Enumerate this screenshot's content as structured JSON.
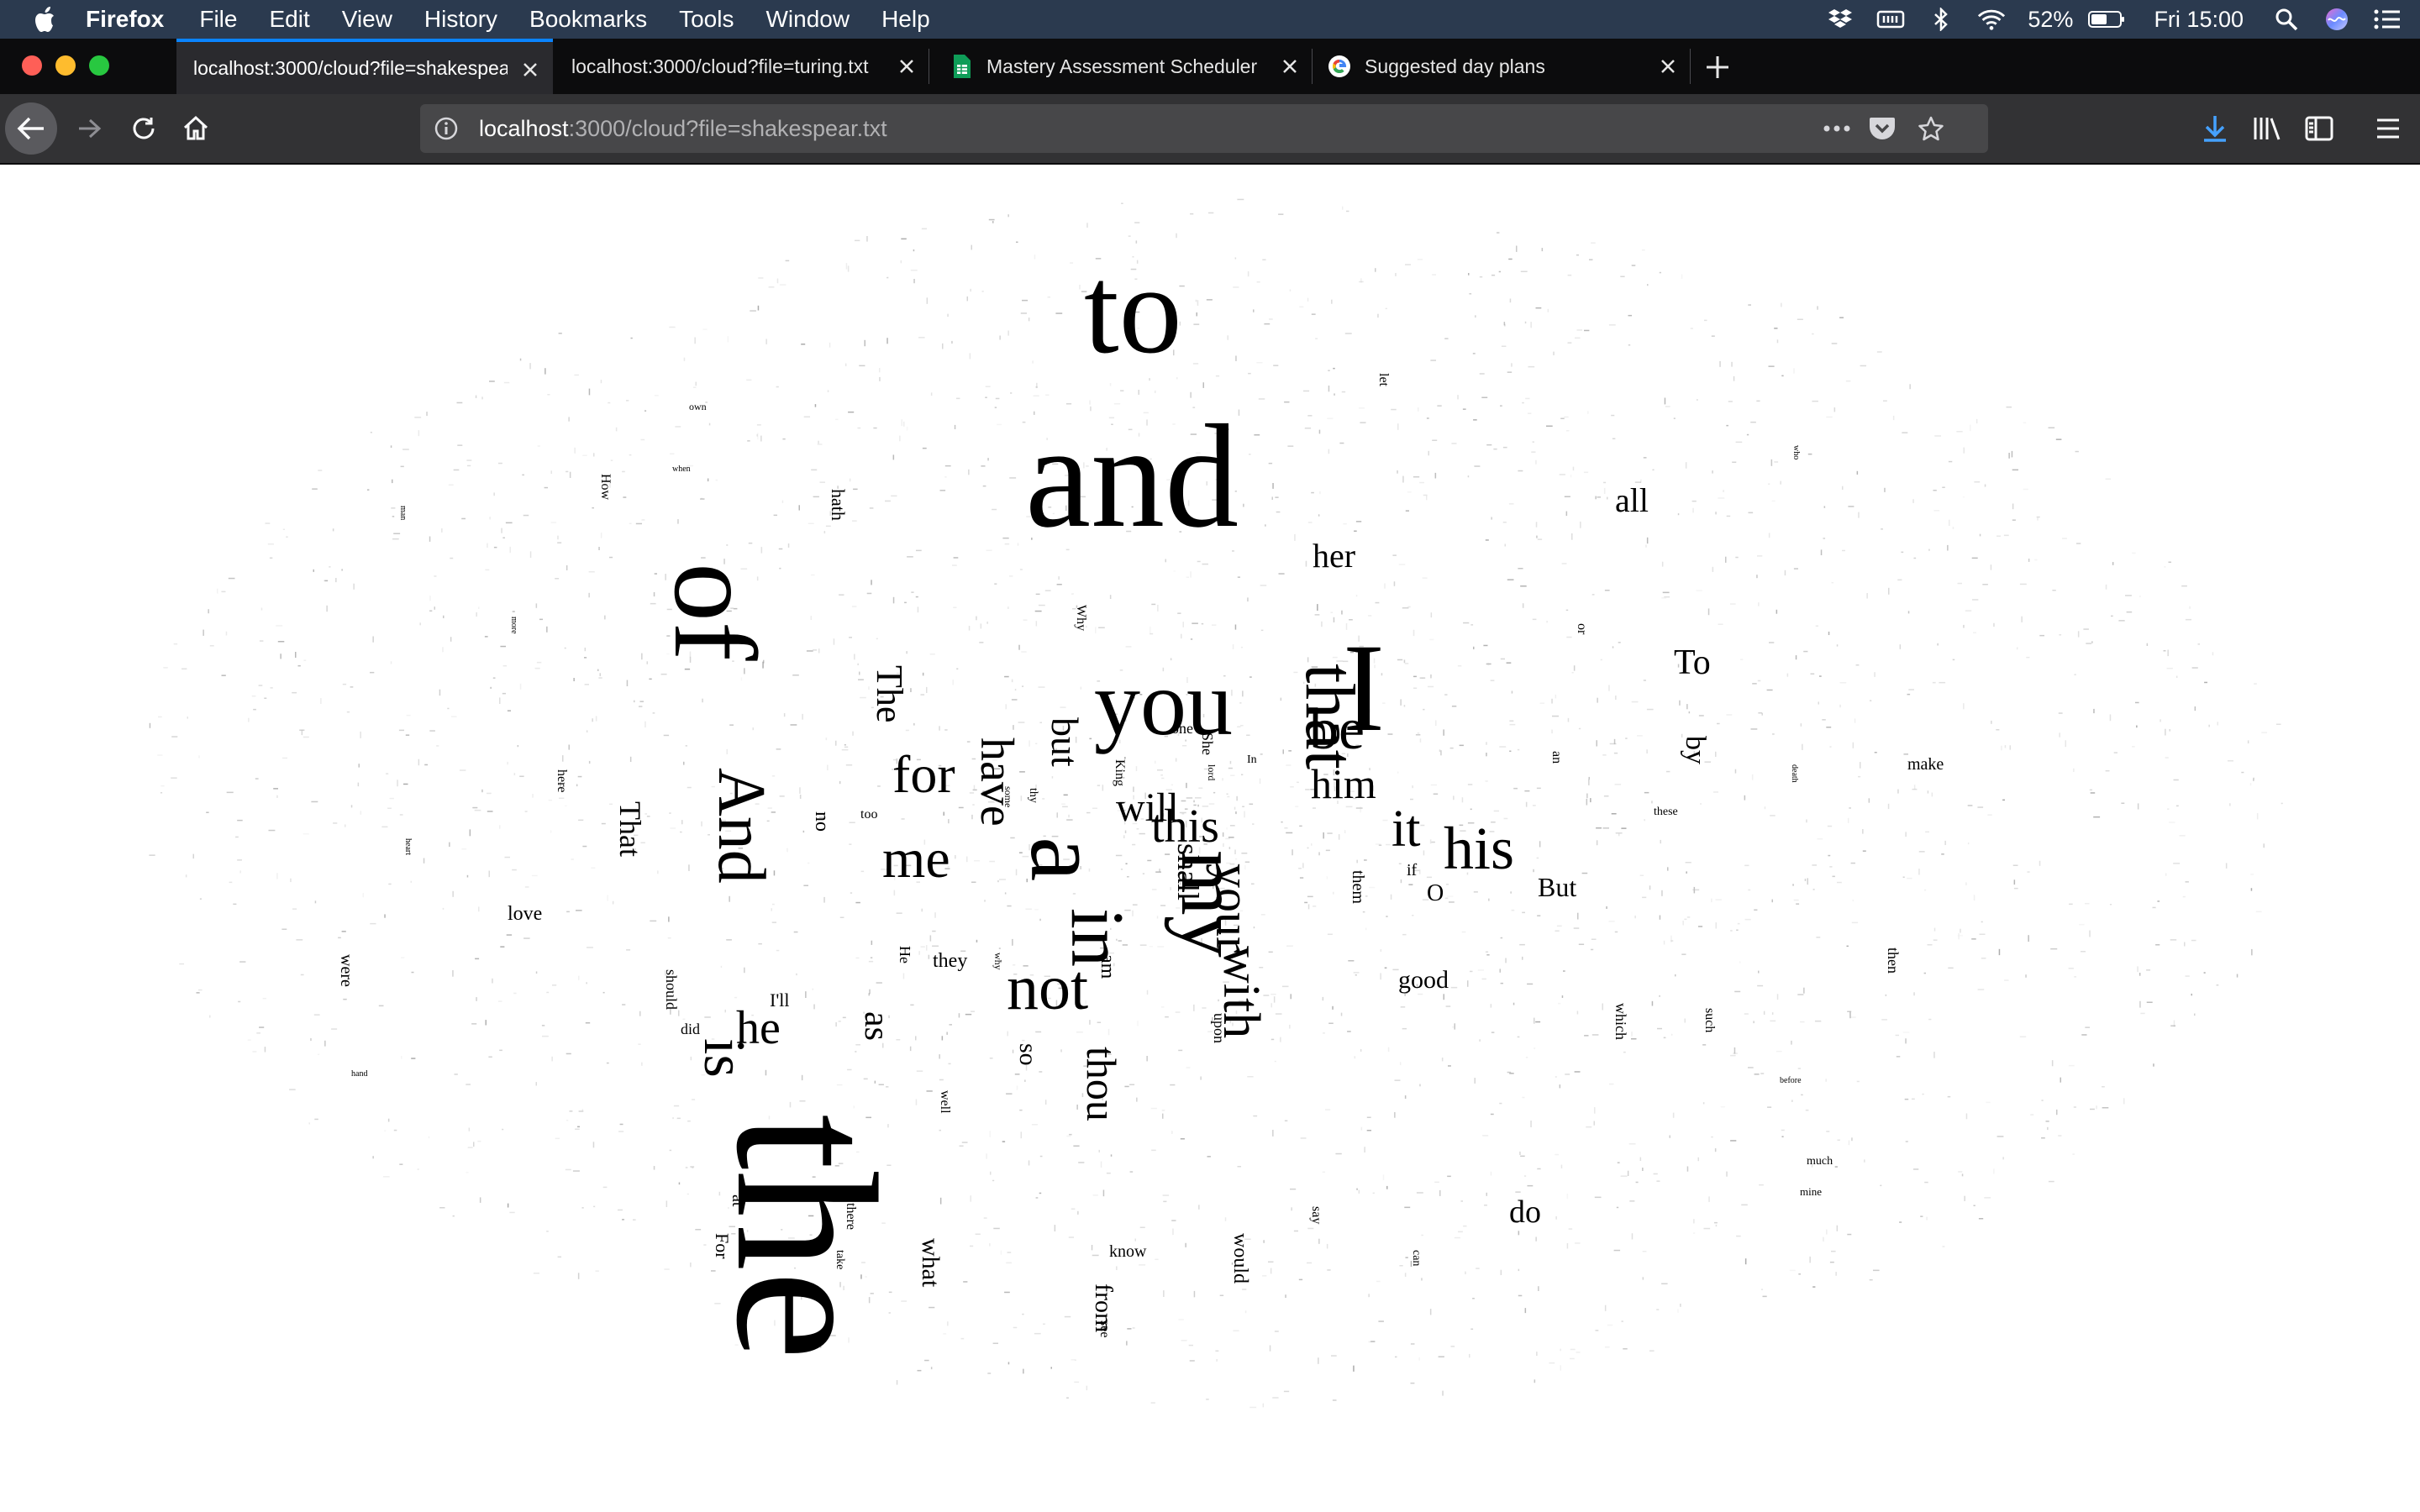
{
  "menubar": {
    "app_name": "Firefox",
    "items": [
      "File",
      "Edit",
      "View",
      "History",
      "Bookmarks",
      "Tools",
      "Window",
      "Help"
    ],
    "battery": "52%",
    "clock": "Fri 15:00",
    "icons": [
      "apple-icon",
      "dropbox-icon",
      "display-icon",
      "bluetooth-icon",
      "wifi-icon",
      "battery-icon",
      "spotlight-search-icon",
      "siri-icon",
      "notification-center-icon"
    ]
  },
  "tabs": [
    {
      "label": "localhost:3000/cloud?file=shakespear.txt",
      "active": true
    },
    {
      "label": "localhost:3000/cloud?file=turing.txt",
      "active": false
    },
    {
      "label": "Mastery Assessment Scheduler",
      "active": false,
      "favicon": "sheets-icon"
    },
    {
      "label": "Suggested day plans",
      "active": false,
      "favicon": "google-icon"
    }
  ],
  "toolbar": {
    "url_host": "localhost",
    "url_rest": ":3000/cloud?file=shakespear.txt"
  },
  "colors": {
    "menubar_bg": "#2b3a4f",
    "tabstrip_bg": "#0c0c0d",
    "active_tab_bg": "#2a2a2e",
    "active_tab_accent": "#0a84ff",
    "toolbar_bg": "#323234",
    "urlbar_bg": "#474749",
    "download_icon": "#45a1ff"
  },
  "word_cloud": {
    "words": [
      {
        "text": "the",
        "size": 240,
        "rotated": true
      },
      {
        "text": "and",
        "size": 176,
        "rotated": false
      },
      {
        "text": "to",
        "size": 150,
        "rotated": false
      },
      {
        "text": "of",
        "size": 140,
        "rotated": true
      },
      {
        "text": "I",
        "size": 150,
        "rotated": false
      },
      {
        "text": "you",
        "size": 110,
        "rotated": false
      },
      {
        "text": "a",
        "size": 120,
        "rotated": true
      },
      {
        "text": "in",
        "size": 90,
        "rotated": true
      },
      {
        "text": "my",
        "size": 100,
        "rotated": true
      },
      {
        "text": "that",
        "size": 84,
        "rotated": true
      },
      {
        "text": "And",
        "size": 80,
        "rotated": true
      },
      {
        "text": "not",
        "size": 76,
        "rotated": false
      },
      {
        "text": "is",
        "size": 70,
        "rotated": true
      },
      {
        "text": "me",
        "size": 66,
        "rotated": false
      },
      {
        "text": "for",
        "size": 64,
        "rotated": false
      },
      {
        "text": "his",
        "size": 72,
        "rotated": false
      },
      {
        "text": "be",
        "size": 70,
        "rotated": false
      },
      {
        "text": "have",
        "size": 56,
        "rotated": true
      },
      {
        "text": "with",
        "size": 62,
        "rotated": true
      },
      {
        "text": "it",
        "size": 62,
        "rotated": false
      },
      {
        "text": "this",
        "size": 56,
        "rotated": false
      },
      {
        "text": "he",
        "size": 56,
        "rotated": false
      },
      {
        "text": "your",
        "size": 58,
        "rotated": true
      },
      {
        "text": "him",
        "size": 50,
        "rotated": false
      },
      {
        "text": "will",
        "size": 48,
        "rotated": false
      },
      {
        "text": "thou",
        "size": 50,
        "rotated": true
      },
      {
        "text": "The",
        "size": 44,
        "rotated": true
      },
      {
        "text": "but",
        "size": 46,
        "rotated": true
      },
      {
        "text": "To",
        "size": 42,
        "rotated": false
      },
      {
        "text": "all",
        "size": 40,
        "rotated": false
      },
      {
        "text": "her",
        "size": 40,
        "rotated": false
      },
      {
        "text": "as",
        "size": 42,
        "rotated": true
      },
      {
        "text": "That",
        "size": 36,
        "rotated": true
      },
      {
        "text": "do",
        "size": 38,
        "rotated": false
      },
      {
        "text": "shall",
        "size": 36,
        "rotated": true
      },
      {
        "text": "by",
        "size": 34,
        "rotated": true
      },
      {
        "text": "But",
        "size": 32,
        "rotated": false
      },
      {
        "text": "good",
        "size": 30,
        "rotated": false
      },
      {
        "text": "love",
        "size": 24,
        "rotated": false
      },
      {
        "text": "so",
        "size": 30,
        "rotated": true
      },
      {
        "text": "what",
        "size": 30,
        "rotated": true
      },
      {
        "text": "O",
        "size": 28,
        "rotated": false
      },
      {
        "text": "from",
        "size": 30,
        "rotated": true
      },
      {
        "text": "hath",
        "size": 22,
        "rotated": true
      },
      {
        "text": "they",
        "size": 24,
        "rotated": false
      },
      {
        "text": "would",
        "size": 24,
        "rotated": true
      },
      {
        "text": "am",
        "size": 24,
        "rotated": true
      },
      {
        "text": "I'll",
        "size": 22,
        "rotated": false
      },
      {
        "text": "no",
        "size": 24,
        "rotated": true
      },
      {
        "text": "them",
        "size": 20,
        "rotated": true
      },
      {
        "text": "make",
        "size": 20,
        "rotated": false
      },
      {
        "text": "were",
        "size": 20,
        "rotated": true
      },
      {
        "text": "upon",
        "size": 18,
        "rotated": true
      },
      {
        "text": "at",
        "size": 20,
        "rotated": true
      },
      {
        "text": "For",
        "size": 22,
        "rotated": true
      },
      {
        "text": "know",
        "size": 20,
        "rotated": false
      },
      {
        "text": "should",
        "size": 18,
        "rotated": true
      },
      {
        "text": "did",
        "size": 18,
        "rotated": false
      },
      {
        "text": "which",
        "size": 18,
        "rotated": true
      },
      {
        "text": "such",
        "size": 16,
        "rotated": true
      },
      {
        "text": "then",
        "size": 18,
        "rotated": true
      },
      {
        "text": "She",
        "size": 18,
        "rotated": true
      },
      {
        "text": "He",
        "size": 18,
        "rotated": true
      },
      {
        "text": "one",
        "size": 18,
        "rotated": false
      },
      {
        "text": "if",
        "size": 20,
        "rotated": false
      },
      {
        "text": "there",
        "size": 16,
        "rotated": true
      },
      {
        "text": "see",
        "size": 16,
        "rotated": true
      },
      {
        "text": "say",
        "size": 16,
        "rotated": true
      },
      {
        "text": "take",
        "size": 14,
        "rotated": true
      },
      {
        "text": "well",
        "size": 16,
        "rotated": true
      },
      {
        "text": "too",
        "size": 16,
        "rotated": false
      },
      {
        "text": "these",
        "size": 14,
        "rotated": false
      },
      {
        "text": "much",
        "size": 14,
        "rotated": false
      },
      {
        "text": "mine",
        "size": 13,
        "rotated": false
      },
      {
        "text": "can",
        "size": 14,
        "rotated": true
      },
      {
        "text": "an",
        "size": 16,
        "rotated": true
      },
      {
        "text": "or",
        "size": 16,
        "rotated": true
      },
      {
        "text": "let",
        "size": 16,
        "rotated": true
      },
      {
        "text": "How",
        "size": 16,
        "rotated": true
      },
      {
        "text": "here",
        "size": 16,
        "rotated": true
      },
      {
        "text": "King",
        "size": 16,
        "rotated": true
      },
      {
        "text": "In",
        "size": 14,
        "rotated": false
      },
      {
        "text": "own",
        "size": 12,
        "rotated": false
      },
      {
        "text": "when",
        "size": 10,
        "rotated": false
      },
      {
        "text": "hand",
        "size": 10,
        "rotated": false
      },
      {
        "text": "before",
        "size": 10,
        "rotated": false
      },
      {
        "text": "heart",
        "size": 10,
        "rotated": true
      },
      {
        "text": "death",
        "size": 10,
        "rotated": true
      },
      {
        "text": "who",
        "size": 10,
        "rotated": true
      },
      {
        "text": "some",
        "size": 12,
        "rotated": true
      },
      {
        "text": "why",
        "size": 12,
        "rotated": true
      },
      {
        "text": "Why",
        "size": 16,
        "rotated": true
      },
      {
        "text": "thy",
        "size": 14,
        "rotated": true
      },
      {
        "text": "more",
        "size": 10,
        "rotated": true
      },
      {
        "text": "man",
        "size": 10,
        "rotated": true
      },
      {
        "text": "lord",
        "size": 12,
        "rotated": true
      }
    ]
  }
}
